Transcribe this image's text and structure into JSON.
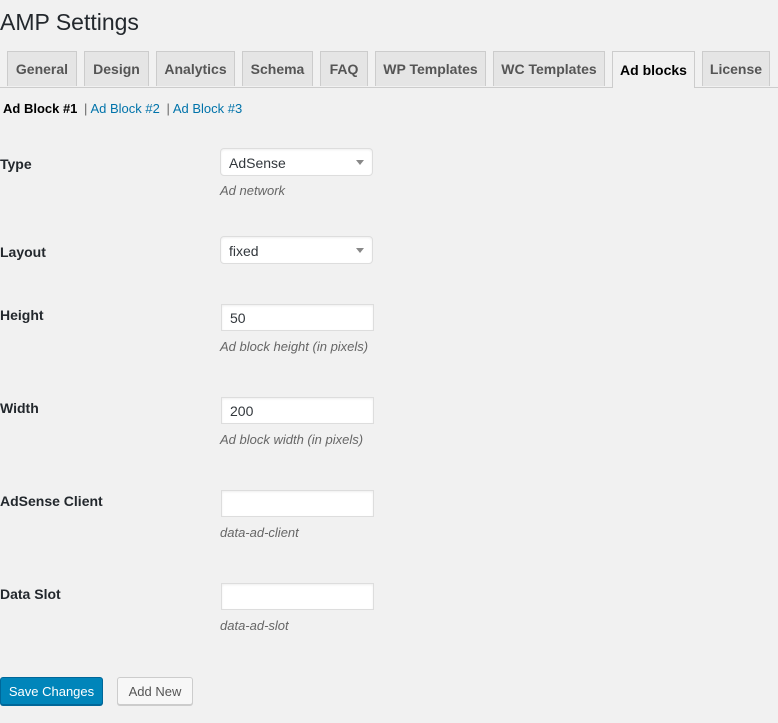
{
  "page": {
    "title": "AMP Settings"
  },
  "tabs": [
    {
      "label": "General",
      "active": false
    },
    {
      "label": "Design",
      "active": false
    },
    {
      "label": "Analytics",
      "active": false
    },
    {
      "label": "Schema",
      "active": false
    },
    {
      "label": "FAQ",
      "active": false
    },
    {
      "label": "WP Templates",
      "active": false
    },
    {
      "label": "WC Templates",
      "active": false
    },
    {
      "label": "Ad blocks",
      "active": true
    },
    {
      "label": "License",
      "active": false
    }
  ],
  "subnav": {
    "current": "Ad Block #1",
    "links": [
      "Ad Block #2",
      "Ad Block #3"
    ],
    "separator": "|"
  },
  "form": {
    "type": {
      "label": "Type",
      "value": "AdSense",
      "description": "Ad network"
    },
    "layout": {
      "label": "Layout",
      "value": "fixed"
    },
    "height": {
      "label": "Height",
      "value": "50",
      "description": "Ad block height (in pixels)"
    },
    "width": {
      "label": "Width",
      "value": "200",
      "description": "Ad block width (in pixels)"
    },
    "client": {
      "label": "AdSense Client",
      "value": "",
      "description": "data-ad-client"
    },
    "slot": {
      "label": "Data Slot",
      "value": "",
      "description": "data-ad-slot"
    }
  },
  "actions": {
    "save": "Save Changes",
    "add_new": "Add New"
  }
}
